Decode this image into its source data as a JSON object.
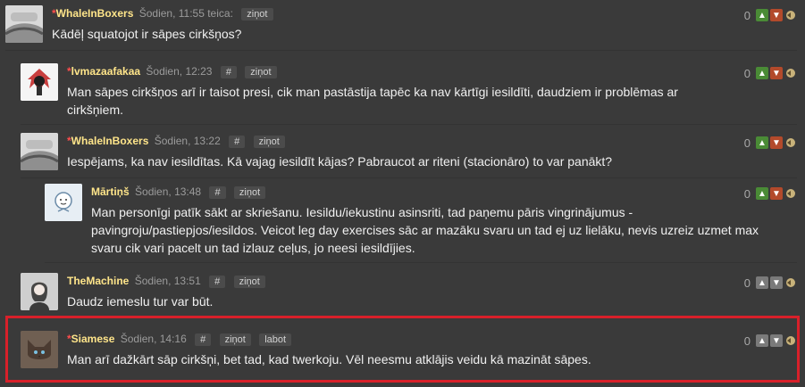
{
  "colors": {
    "background": "#3a3a3a",
    "author": "#ffe58a",
    "star": "#ff4d4d",
    "highlight_border": "#d8202a",
    "upvote": "#4a8b36",
    "downvote": "#b34a2b"
  },
  "comments": [
    {
      "star": "*",
      "author": "WhaleInBoxers",
      "time": "Šodien, 11:55 teica:",
      "links": [
        "ziņot"
      ],
      "text": "Kādēļ squatojot ir sāpes cirkšņos?",
      "score": "0",
      "avatar_icon": "pillow-avatar-icon"
    },
    {
      "star": "*",
      "author": "lvmazaafakaa",
      "time": "Šodien, 12:23",
      "links": [
        "#",
        "ziņot"
      ],
      "text": "Man sāpes cirkšņos arī ir taisot presi, cik man pastāstija tapēc ka nav kārtīgi iesildīti, daudziem ir problēmas ar cirkšņiem.",
      "score": "0",
      "avatar_icon": "headdress-avatar-icon"
    },
    {
      "star": "*",
      "author": "WhaleInBoxers",
      "time": "Šodien, 13:22",
      "links": [
        "#",
        "ziņot"
      ],
      "text": "Iespējams, ka nav iesildītas. Kā vajag iesildīt kājas? Pabraucot ar riteni (stacionāro) to var panākt?",
      "score": "0",
      "avatar_icon": "pillow-avatar-icon"
    },
    {
      "star": "",
      "author": "Mārtiņš",
      "time": "Šodien, 13:48",
      "links": [
        "#",
        "ziņot"
      ],
      "text": "Man personīgi patīk sākt ar skriešanu. Iesildu/iekustinu asinsriti, tad paņemu pāris vingrinājumus - pavingroju/pastiepjos/iesildos. Veicot leg day exercises sāc ar mazāku svaru un tad ej uz lielāku, nevis uzreiz uzmet max svaru cik vari pacelt un tad izlauz ceļus, jo neesi iesildījies.",
      "score": "0",
      "avatar_icon": "doodle-avatar-icon"
    },
    {
      "star": "",
      "author": "TheMachine",
      "time": "Šodien, 13:51",
      "links": [
        "#",
        "ziņot"
      ],
      "text": "Daudz iemeslu tur var būt.",
      "score": "0",
      "avatar_icon": "woman-avatar-icon"
    },
    {
      "star": "*",
      "author": "Siamese",
      "time": "Šodien, 14:16",
      "links": [
        "#",
        "ziņot",
        "labot"
      ],
      "text": "Man arī dažkārt sāp cirkšņi, bet tad, kad twerkoju. Vēl neesmu atklājis veidu kā mazināt sāpes.",
      "score": "0",
      "avatar_icon": "cat-avatar-icon"
    }
  ]
}
